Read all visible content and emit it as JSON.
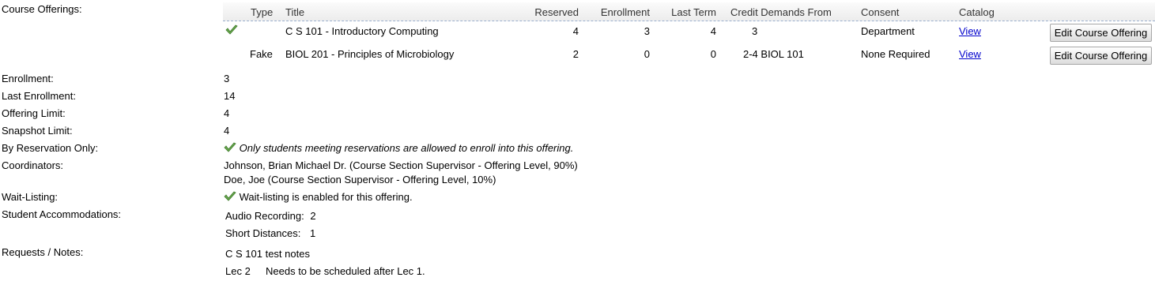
{
  "labels": {
    "course_offerings": "Course Offerings:",
    "enrollment": "Enrollment:",
    "last_enrollment": "Last Enrollment:",
    "offering_limit": "Offering Limit:",
    "snapshot_limit": "Snapshot Limit:",
    "by_reservation_only": "By Reservation Only:",
    "coordinators": "Coordinators:",
    "wait_listing": "Wait-Listing:",
    "student_accommodations": "Student Accommodations:",
    "requests_notes": "Requests / Notes:"
  },
  "offerings_table": {
    "headers": {
      "type": "Type",
      "title": "Title",
      "reserved": "Reserved",
      "enrollment": "Enrollment",
      "last_term": "Last Term",
      "credit_demands_from": "Credit Demands From",
      "consent": "Consent",
      "catalog": "Catalog"
    },
    "rows": [
      {
        "controlling_icon": "check-icon",
        "type": "",
        "title": "C S 101 - Introductory Computing",
        "reserved": "4",
        "enrollment": "3",
        "last_term": "4",
        "credit_demands_from": "3",
        "consent": "Department",
        "catalog": "View",
        "action": "Edit Course Offering"
      },
      {
        "controlling_icon": "",
        "type": "Fake",
        "title": "BIOL 201 - Principles of Microbiology",
        "reserved": "2",
        "enrollment": "0",
        "last_term": "0",
        "credit_demands_from": "2-4 BIOL 101",
        "consent": "None Required",
        "catalog": "View",
        "action": "Edit Course Offering"
      }
    ]
  },
  "values": {
    "enrollment": "3",
    "last_enrollment": "14",
    "offering_limit": "4",
    "snapshot_limit": "4",
    "by_reservation_only": "Only students meeting reservations are allowed to enroll into this offering.",
    "coordinators": [
      "Johnson, Brian Michael Dr. (Course Section Supervisor - Offering Level, 90%)",
      "Doe, Joe (Course Section Supervisor - Offering Level, 10%)"
    ],
    "wait_listing": "Wait-listing is enabled for this offering.",
    "accommodations": [
      {
        "name": "Audio Recording:",
        "count": "2"
      },
      {
        "name": "Short Distances:",
        "count": "1"
      }
    ],
    "notes": [
      {
        "subpart": "",
        "text": "C S 101 test notes"
      },
      {
        "subpart": "Lec 2",
        "text": "Needs to be scheduled after Lec 1."
      }
    ]
  },
  "colors": {
    "check": "#6aa84f",
    "link": "#0000cc",
    "header_divider": "#9cb0ce"
  }
}
